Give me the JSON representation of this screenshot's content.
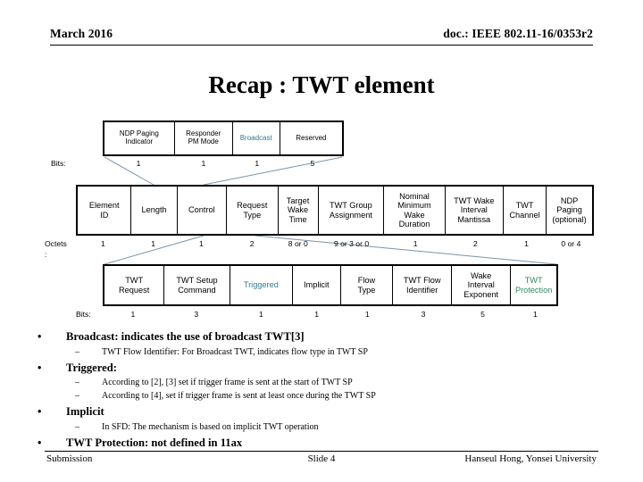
{
  "header": {
    "left": "March 2016",
    "right": "doc.: IEEE 802.11-16/0353r2"
  },
  "title": "Recap : TWT element",
  "colors": {
    "highlight_teal": "#2E7D8F",
    "highlight_green": "#2E8B62",
    "text": "#000000",
    "connector": "#7A93A8"
  },
  "diagram": {
    "control_field": {
      "label_bits": "Bits:",
      "cells": [
        {
          "label": "NDP Paging\nIndicator",
          "bits": "1",
          "color": "#000000",
          "width_pct": 29.6
        },
        {
          "label": "Responder\nPM Mode",
          "bits": "1",
          "color": "#000000",
          "width_pct": 24.4
        },
        {
          "label": "Broadcast",
          "bits": "1",
          "color": "#2E7D8F",
          "width_pct": 20.0
        },
        {
          "label": "Reserved",
          "bits": "5",
          "color": "#000000",
          "width_pct": 26.0
        }
      ]
    },
    "twt_element": {
      "label_octets": "Octets\n:",
      "cells": [
        {
          "label": "Element\nID",
          "octets": "1",
          "color": "#000000",
          "width_pct": 10.5
        },
        {
          "label": "Length",
          "octets": "1",
          "color": "#000000",
          "width_pct": 8.9
        },
        {
          "label": "Control",
          "octets": "1",
          "color": "#000000",
          "width_pct": 9.6
        },
        {
          "label": "Request\nType",
          "octets": "2",
          "color": "#000000",
          "width_pct": 10.0
        },
        {
          "label": "Target\nWake\nTime",
          "octets": "8 or 0",
          "color": "#000000",
          "width_pct": 7.8
        },
        {
          "label": "TWT Group\nAssignment",
          "octets": "9 or 3 or 0",
          "color": "#000000",
          "width_pct": 12.8
        },
        {
          "label": "Nominal\nMinimum\nWake\nDuration",
          "octets": "1",
          "color": "#000000",
          "width_pct": 11.9
        },
        {
          "label": "TWT Wake\nInterval\nMantissa",
          "octets": "2",
          "color": "#000000",
          "width_pct": 11.3
        },
        {
          "label": "TWT\nChannel",
          "octets": "1",
          "color": "#000000",
          "width_pct": 8.4
        },
        {
          "label": "NDP\nPaging\n(optional)",
          "octets": "0 or 4",
          "color": "#000000",
          "width_pct": 8.8
        }
      ]
    },
    "request_type_field": {
      "label_bits": "Bits:",
      "cells": [
        {
          "label": "TWT\nRequest",
          "bits": "1",
          "color": "#000000",
          "width_pct": 13.3
        },
        {
          "label": "TWT Setup\nCommand",
          "bits": "3",
          "color": "#000000",
          "width_pct": 14.5
        },
        {
          "label": "Triggered",
          "bits": "1",
          "color": "#2E7D8F",
          "width_pct": 13.9
        },
        {
          "label": "Implicit",
          "bits": "1",
          "color": "#000000",
          "width_pct": 10.6
        },
        {
          "label": "Flow\nType",
          "bits": "1",
          "color": "#000000",
          "width_pct": 11.6
        },
        {
          "label": "TWT Flow\nIdentifier",
          "bits": "3",
          "color": "#000000",
          "width_pct": 13.0
        },
        {
          "label": "Wake\nInterval\nExponent",
          "bits": "5",
          "color": "#000000",
          "width_pct": 13.1
        },
        {
          "label": "TWT\nProtection",
          "bits": "1",
          "color": "#2E8B62",
          "width_pct": 10.0
        }
      ]
    }
  },
  "bullets": [
    {
      "level": 1,
      "marker": "•",
      "text": "Broadcast: indicates the use of broadcast TWT[3]"
    },
    {
      "level": 2,
      "marker": "–",
      "text": "TWT Flow Identifier: For Broadcast TWT, indicates flow type in TWT SP"
    },
    {
      "level": 1,
      "marker": "•",
      "text": "Triggered:"
    },
    {
      "level": 2,
      "marker": "–",
      "text": "According to [2], [3] set if trigger frame is sent at the start of TWT SP"
    },
    {
      "level": 2,
      "marker": "–",
      "text": "According to [4], set if trigger frame is sent at least once during the TWT SP"
    },
    {
      "level": 1,
      "marker": "•",
      "text": "Implicit"
    },
    {
      "level": 2,
      "marker": "–",
      "text": "In SFD: The mechanism is based on implicit TWT operation"
    },
    {
      "level": 1,
      "marker": "•",
      "text": "TWT Protection: not defined in 11ax"
    }
  ],
  "footer": {
    "left": "Submission",
    "center": "Slide 4",
    "right": "Hanseul Hong, Yonsei University"
  }
}
